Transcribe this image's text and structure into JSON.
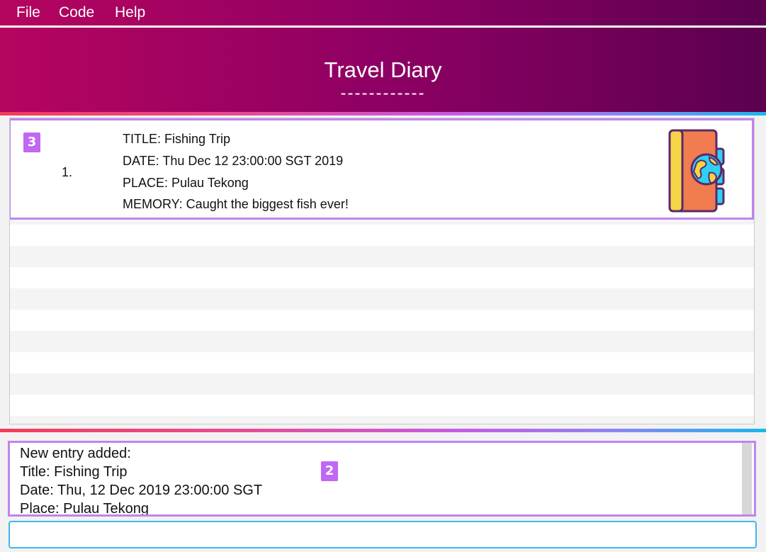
{
  "menu": {
    "items": [
      {
        "label": "File"
      },
      {
        "label": "Code"
      },
      {
        "label": "Help"
      }
    ]
  },
  "header": {
    "title": "Travel Diary",
    "underline": "------------"
  },
  "entries": [
    {
      "badge": "3",
      "index": "1.",
      "title": "TITLE: Fishing Trip",
      "date": "DATE: Thu Dec 12 23:00:00 SGT 2019",
      "place": "PLACE: Pulau Tekong",
      "memory": "MEMORY: Caught the biggest fish ever!",
      "icon": "travel-diary-book-icon"
    }
  ],
  "result": {
    "badge": "2",
    "lines": [
      "New entry added:",
      "Title: Fishing Trip",
      "Date: Thu, 12 Dec 2019 23:00:00 SGT",
      "Place: Pulau Tekong"
    ]
  },
  "command": {
    "value": "",
    "placeholder": ""
  },
  "colors": {
    "header_start": "#b5055f",
    "header_end": "#5c0050",
    "highlight": "#c084f0",
    "badge": "#c067f3",
    "input_border": "#3cb9ee"
  }
}
